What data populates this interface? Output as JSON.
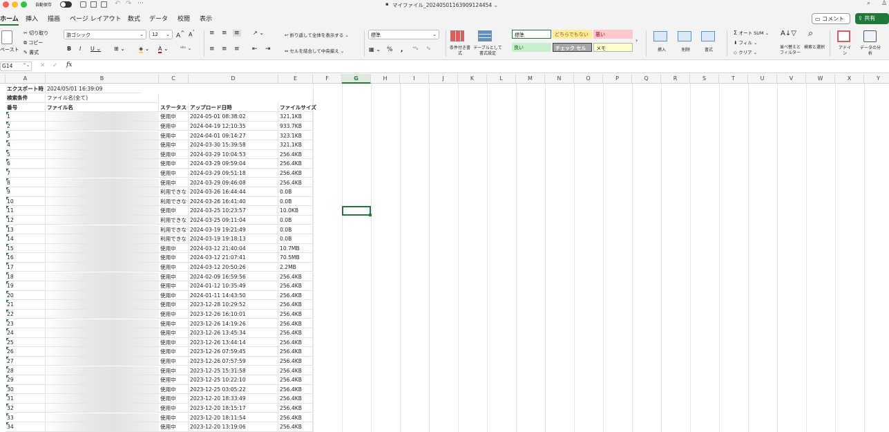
{
  "titlebar": {
    "autosave": "自動保存",
    "title": "マイファイル_20240501163909124454 ⌄"
  },
  "tabs": [
    "ホーム",
    "挿入",
    "描画",
    "ページ レイアウト",
    "数式",
    "データ",
    "校閲",
    "表示"
  ],
  "comment_button": "コメント",
  "share_button": "共有",
  "ribbon": {
    "paste": "ペースト",
    "cut": "切り取り",
    "copy": "コピー",
    "format_painter": "書式",
    "font_name": "游ゴシック",
    "font_size": "12",
    "wrap_text": "折り返して全体を表示する",
    "merge_center": "セルを結合して中央揃え",
    "number_format": "標準",
    "conditional_format": "条件付き書式",
    "table_format": "テーブルとして書式設定",
    "styles": {
      "normal": "標準",
      "neutral": "どちらでもない",
      "bad": "悪い",
      "good": "良い",
      "check": "チェック セル",
      "memo": "メモ"
    },
    "insert": "挿入",
    "delete": "削除",
    "format": "書式",
    "autosum": "オート SUM",
    "fill": "フィル",
    "clear": "クリア",
    "sort_filter": "並べ替えとフィルター",
    "find_select": "検索と選択",
    "addins": "アドイン",
    "analyze": "データの分析"
  },
  "formula_bar": {
    "name_box": "G14",
    "fx": "fx"
  },
  "columns": [
    "A",
    "B",
    "C",
    "D",
    "E",
    "F",
    "G",
    "H",
    "I",
    "J",
    "K",
    "L",
    "M",
    "N",
    "O",
    "P",
    "Q",
    "R",
    "S",
    "T",
    "U",
    "V",
    "W",
    "X",
    "Y"
  ],
  "sheet": {
    "export_label": "エクスポート時",
    "export_value": "2024/05/01 16:39:09",
    "search_label": "検索条件",
    "search_value": "ファイル名(全て)",
    "headers": [
      "番号",
      "ファイル名",
      "ステータス",
      "アップロード日時",
      "ファイルサイズ"
    ],
    "rows": [
      [
        "1",
        "使用中",
        "2024-05-01 08:38:02",
        "321.1KB"
      ],
      [
        "2",
        "使用中",
        "2024-04-19 12:10:35",
        "933.7KB"
      ],
      [
        "3",
        "使用中",
        "2024-04-01 09:14:27",
        "323.1KB"
      ],
      [
        "4",
        "使用中",
        "2024-03-30 15:39:58",
        "321.1KB"
      ],
      [
        "5",
        "使用中",
        "2024-03-29 10:04:53",
        "256.4KB"
      ],
      [
        "6",
        "使用中",
        "2024-03-29 09:59:04",
        "256.4KB"
      ],
      [
        "7",
        "使用中",
        "2024-03-29 09:51:18",
        "256.4KB"
      ],
      [
        "8",
        "使用中",
        "2024-03-29 09:46:08",
        "256.4KB"
      ],
      [
        "9",
        "利用できな",
        "2024-03-26 16:44:44",
        "0.0B"
      ],
      [
        "10",
        "利用できな",
        "2024-03-26 16:41:40",
        "0.0B"
      ],
      [
        "11",
        "使用中",
        "2024-03-25 10:23:57",
        "10.0KB"
      ],
      [
        "12",
        "利用できな",
        "2024-03-25 09:11:04",
        "0.0B"
      ],
      [
        "13",
        "利用できな",
        "2024-03-19 19:21:49",
        "0.0B"
      ],
      [
        "14",
        "利用できな",
        "2024-03-19 19:18:13",
        "0.0B"
      ],
      [
        "15",
        "使用中",
        "2024-03-12 21:40:04",
        "10.7MB"
      ],
      [
        "16",
        "使用中",
        "2024-03-12 21:07:41",
        "70.5MB"
      ],
      [
        "17",
        "使用中",
        "2024-03-12 20:50:26",
        "2.2MB"
      ],
      [
        "18",
        "使用中",
        "2024-02-09 16:59:56",
        "256.4KB"
      ],
      [
        "19",
        "使用中",
        "2024-01-12 10:35:49",
        "256.4KB"
      ],
      [
        "20",
        "使用中",
        "2024-01-11 14:43:50",
        "256.4KB"
      ],
      [
        "21",
        "使用中",
        "2023-12-28 10:29:52",
        "256.4KB"
      ],
      [
        "22",
        "使用中",
        "2023-12-26 16:10:01",
        "256.4KB"
      ],
      [
        "23",
        "使用中",
        "2023-12-26 14:19:26",
        "256.4KB"
      ],
      [
        "24",
        "使用中",
        "2023-12-26 13:45:34",
        "256.4KB"
      ],
      [
        "25",
        "使用中",
        "2023-12-26 13:44:14",
        "256.4KB"
      ],
      [
        "26",
        "使用中",
        "2023-12-26 07:59:45",
        "256.4KB"
      ],
      [
        "27",
        "使用中",
        "2023-12-26 07:57:59",
        "256.4KB"
      ],
      [
        "28",
        "使用中",
        "2023-12-25 15:31:58",
        "256.4KB"
      ],
      [
        "29",
        "使用中",
        "2023-12-25 10:22:10",
        "256.4KB"
      ],
      [
        "30",
        "使用中",
        "2023-12-25 03:05:22",
        "256.4KB"
      ],
      [
        "31",
        "使用中",
        "2023-12-20 18:33:49",
        "256.4KB"
      ],
      [
        "32",
        "使用中",
        "2023-12-20 18:15:17",
        "256.4KB"
      ],
      [
        "33",
        "使用中",
        "2023-12-20 18:11:54",
        "256.4KB"
      ],
      [
        "34",
        "使用中",
        "2023-12-20 13:19:06",
        "256.4KB"
      ]
    ]
  }
}
